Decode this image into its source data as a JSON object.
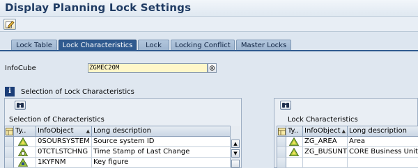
{
  "title": "Display Planning Lock Settings",
  "tabs": [
    {
      "label": "Lock Table",
      "active": false
    },
    {
      "label": "Lock Characteristics",
      "active": true
    },
    {
      "label": "Lock",
      "active": false
    },
    {
      "label": "Locking Conflict",
      "active": false
    },
    {
      "label": "Master Locks",
      "active": false
    }
  ],
  "infocube": {
    "label": "InfoCube",
    "value": "ZGMEC20M"
  },
  "selection_of_lock_characteristics": "Selection of Lock Characteristics",
  "left_panel": {
    "title": "Selection of Characteristics",
    "headers": [
      "Ty..",
      "InfoObject",
      "Long description"
    ],
    "rows": [
      {
        "type_icon": "characteristic-icon",
        "infoobject": "0SOURSYSTEM",
        "description": "Source system ID"
      },
      {
        "type_icon": "time-characteristic-icon",
        "infoobject": "0TCTLSTCHNG",
        "description": "Time Stamp of Last Change"
      },
      {
        "type_icon": "key-figure-icon",
        "infoobject": "1KYFNM",
        "description": "Key figure"
      }
    ]
  },
  "right_panel": {
    "title": "Lock Characteristics",
    "headers": [
      "Ty..",
      "InfoObject",
      "Long description"
    ],
    "rows": [
      {
        "type_icon": "characteristic-icon",
        "infoobject": "ZG_AREA",
        "description": "Area"
      },
      {
        "type_icon": "characteristic-icon",
        "infoobject": "ZG_BUSUNT",
        "description": "CORE Business Unit"
      }
    ]
  },
  "colors": {
    "accent": "#2f5a8f",
    "title": "#1f3b63",
    "input_bg": "#fff7c9"
  }
}
